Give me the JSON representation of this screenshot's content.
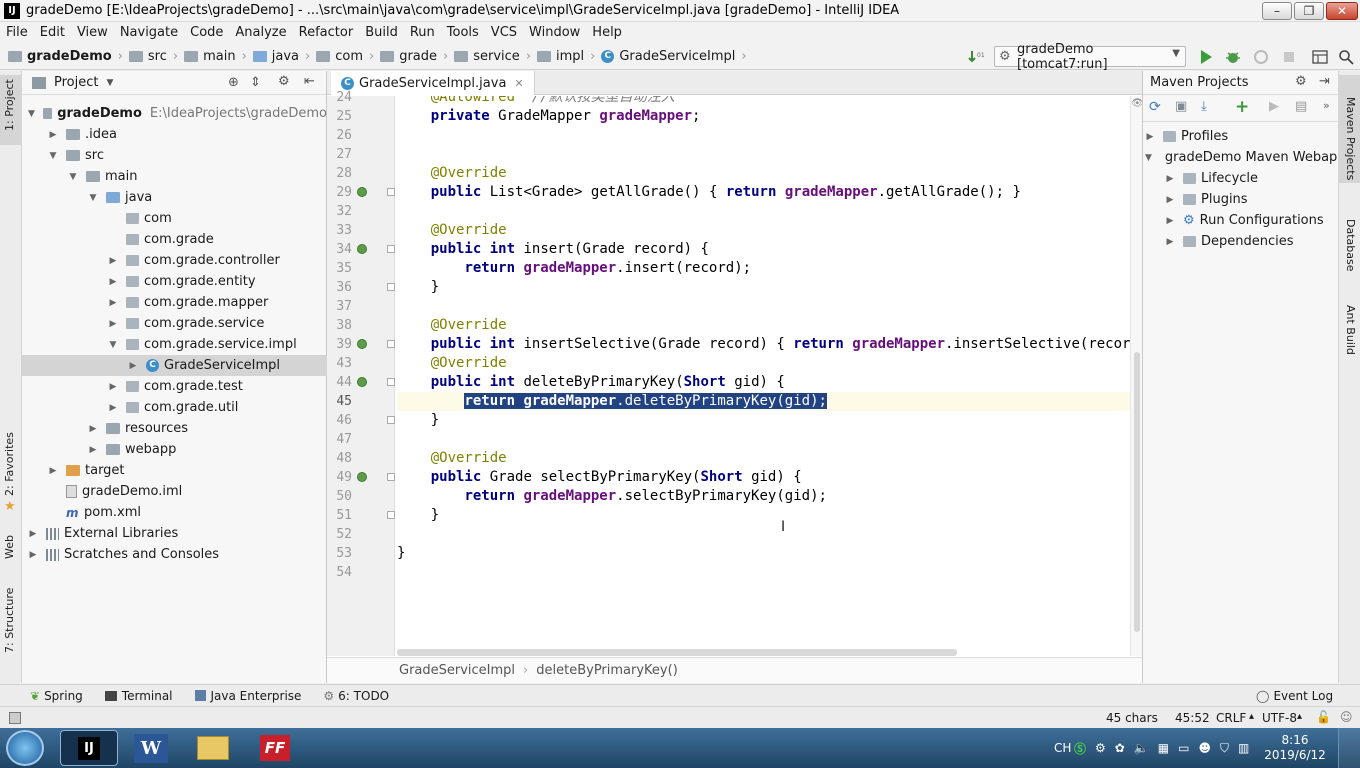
{
  "window": {
    "title": "gradeDemo [E:\\IdeaProjects\\gradeDemo] - ...\\src\\main\\java\\com\\grade\\service\\impl\\GradeServiceImpl.java [gradeDemo] - IntelliJ IDEA",
    "app_icon": "IJ"
  },
  "menu": [
    "File",
    "Edit",
    "View",
    "Navigate",
    "Code",
    "Analyze",
    "Refactor",
    "Build",
    "Run",
    "Tools",
    "VCS",
    "Window",
    "Help"
  ],
  "breadcrumb": [
    "gradeDemo",
    "src",
    "main",
    "java",
    "com",
    "grade",
    "service",
    "impl",
    "GradeServiceImpl"
  ],
  "run_config": "gradeDemo [tomcat7:run]",
  "left_stripe": {
    "project": "1: Project",
    "favorites": "2: Favorites",
    "web": "Web",
    "structure": "7: Structure"
  },
  "project_panel": {
    "title": "Project",
    "tree": [
      {
        "label": "gradeDemo",
        "extra": "E:\\IdeaProjects\\gradeDemo",
        "arrow": "open",
        "icon": "folder"
      },
      {
        "label": ".idea",
        "arrow": "closed",
        "icon": "folder"
      },
      {
        "label": "src",
        "arrow": "open",
        "icon": "folder"
      },
      {
        "label": "main",
        "arrow": "open",
        "icon": "folder"
      },
      {
        "label": "java",
        "arrow": "open",
        "icon": "folder-blue"
      },
      {
        "label": "com",
        "arrow": "none",
        "icon": "package"
      },
      {
        "label": "com.grade",
        "arrow": "none",
        "icon": "package"
      },
      {
        "label": "com.grade.controller",
        "arrow": "closed",
        "icon": "package"
      },
      {
        "label": "com.grade.entity",
        "arrow": "closed",
        "icon": "package"
      },
      {
        "label": "com.grade.mapper",
        "arrow": "closed",
        "icon": "package"
      },
      {
        "label": "com.grade.service",
        "arrow": "closed",
        "icon": "package"
      },
      {
        "label": "com.grade.service.impl",
        "arrow": "open",
        "icon": "package"
      },
      {
        "label": "GradeServiceImpl",
        "arrow": "closed",
        "icon": "class",
        "selected": true
      },
      {
        "label": "com.grade.test",
        "arrow": "closed",
        "icon": "package"
      },
      {
        "label": "com.grade.util",
        "arrow": "closed",
        "icon": "package"
      },
      {
        "label": "resources",
        "arrow": "closed",
        "icon": "folder"
      },
      {
        "label": "webapp",
        "arrow": "closed",
        "icon": "folder"
      },
      {
        "label": "target",
        "arrow": "closed",
        "icon": "folder-orange"
      },
      {
        "label": "gradeDemo.iml",
        "arrow": "none",
        "icon": "file"
      },
      {
        "label": "pom.xml",
        "arrow": "none",
        "icon": "maven"
      },
      {
        "label": "External Libraries",
        "arrow": "closed",
        "icon": "library"
      },
      {
        "label": "Scratches and Consoles",
        "arrow": "closed",
        "icon": "scratch"
      }
    ]
  },
  "editor": {
    "tab": "GradeServiceImpl.java",
    "lines": [
      {
        "n": "24",
        "text": "    @Autowired  //默认按类型自动注入"
      },
      {
        "n": "25",
        "text": "    private GradeMapper gradeMapper;"
      },
      {
        "n": "26",
        "text": ""
      },
      {
        "n": "27",
        "text": ""
      },
      {
        "n": "28",
        "text": "    @Override"
      },
      {
        "n": "29",
        "text": "    public List<Grade> getAllGrade() { return gradeMapper.getAllGrade(); }"
      },
      {
        "n": "32",
        "text": ""
      },
      {
        "n": "33",
        "text": "    @Override"
      },
      {
        "n": "34",
        "text": "    public int insert(Grade record) {"
      },
      {
        "n": "35",
        "text": "        return gradeMapper.insert(record);"
      },
      {
        "n": "36",
        "text": "    }"
      },
      {
        "n": "37",
        "text": ""
      },
      {
        "n": "38",
        "text": "    @Override"
      },
      {
        "n": "39",
        "text": "    public int insertSelective(Grade record) { return gradeMapper.insertSelective(record); }"
      },
      {
        "n": "43",
        "text": "    @Override"
      },
      {
        "n": "44",
        "text": "    public int deleteByPrimaryKey(Short gid) {"
      },
      {
        "n": "45",
        "text": "        return gradeMapper.deleteByPrimaryKey(gid);"
      },
      {
        "n": "46",
        "text": "    }"
      },
      {
        "n": "47",
        "text": ""
      },
      {
        "n": "48",
        "text": "    @Override"
      },
      {
        "n": "49",
        "text": "    public Grade selectByPrimaryKey(Short gid) {"
      },
      {
        "n": "50",
        "text": "        return gradeMapper.selectByPrimaryKey(gid);"
      },
      {
        "n": "51",
        "text": "    }"
      },
      {
        "n": "52",
        "text": ""
      },
      {
        "n": "53",
        "text": "}"
      },
      {
        "n": "54",
        "text": ""
      }
    ],
    "breadcrumb": [
      "GradeServiceImpl",
      "deleteByPrimaryKey()"
    ]
  },
  "maven": {
    "title": "Maven Projects",
    "items": [
      {
        "label": "Profiles",
        "arrow": "closed",
        "indent": 0
      },
      {
        "label": "gradeDemo Maven Webapp",
        "arrow": "open",
        "indent": 0
      },
      {
        "label": "Lifecycle",
        "arrow": "closed",
        "indent": 1
      },
      {
        "label": "Plugins",
        "arrow": "closed",
        "indent": 1
      },
      {
        "label": "Run Configurations",
        "arrow": "closed",
        "indent": 1
      },
      {
        "label": "Dependencies",
        "arrow": "closed",
        "indent": 1
      }
    ]
  },
  "right_stripe": {
    "maven": "Maven Projects",
    "database": "Database",
    "ant": "Ant Build"
  },
  "tool_windows": [
    "Spring",
    "Terminal",
    "Java Enterprise",
    "6: TODO"
  ],
  "event_log": "Event Log",
  "status": {
    "chars": "45 chars",
    "position": "45:52",
    "line_sep": "CRLF",
    "encoding": "UTF-8"
  },
  "taskbar": {
    "apps": [
      "IJ",
      "W",
      "",
      "FF"
    ],
    "lang": "CH",
    "time": "8:16",
    "date": "2019/6/12"
  },
  "colors": {
    "keyword": "#000080",
    "annotation": "#808000",
    "field": "#660e7a",
    "selection": "#214283"
  }
}
